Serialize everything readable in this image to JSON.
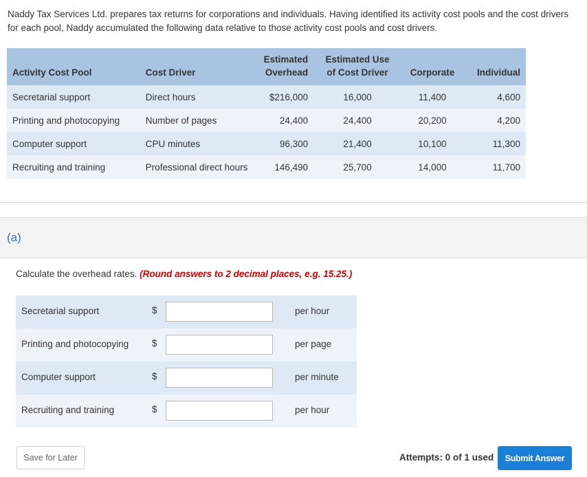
{
  "intro": "Naddy Tax Services Ltd. prepares tax returns for corporations and individuals. Having identified its activity cost pools and the cost drivers for each pool, Naddy accumulated the following data relative to those activity cost pools and cost drivers.",
  "table": {
    "headers": {
      "pool": "Activity Cost Pool",
      "driver": "Cost Driver",
      "overhead_line1": "Estimated",
      "overhead_line2": "Overhead",
      "use_line1": "Estimated Use",
      "use_line2": "of Cost Driver",
      "corporate": "Corporate",
      "individual": "Individual"
    },
    "rows": [
      {
        "pool": "Secretarial support",
        "driver": "Direct hours",
        "overhead": "$216,000",
        "use": "16,000",
        "corporate": "11,400",
        "individual": "4,600"
      },
      {
        "pool": "Printing and photocopying",
        "driver": "Number of pages",
        "overhead": "24,400",
        "use": "24,400",
        "corporate": "20,200",
        "individual": "4,200"
      },
      {
        "pool": "Computer support",
        "driver": "CPU minutes",
        "overhead": "96,300",
        "use": "21,400",
        "corporate": "10,100",
        "individual": "11,300"
      },
      {
        "pool": "Recruiting and training",
        "driver": "Professional direct hours",
        "overhead": "146,490",
        "use": "25,700",
        "corporate": "14,000",
        "individual": "11,700"
      }
    ]
  },
  "part_label": "(a)",
  "instruction": {
    "text": "Calculate the overhead rates. ",
    "emphasis": "(Round answers to 2 decimal places, e.g. 15.25.)"
  },
  "answers": [
    {
      "label": "Secretarial support",
      "currency": "$",
      "value": "",
      "unit": "per hour"
    },
    {
      "label": "Printing and photocopying",
      "currency": "$",
      "value": "",
      "unit": "per page"
    },
    {
      "label": "Computer support",
      "currency": "$",
      "value": "",
      "unit": "per minute"
    },
    {
      "label": "Recruiting and training",
      "currency": "$",
      "value": "",
      "unit": "per hour"
    }
  ],
  "footer": {
    "save_label": "Save for Later",
    "attempts": "Attempts: 0 of 1 used",
    "submit_label": "Submit Answer"
  },
  "colors": {
    "header_bg": "#a9c4e1",
    "row_alt_bg": "#dfe9f5",
    "submit_bg": "#1a7fd6",
    "emphasis": "#cc0000",
    "part_label": "#3a6fb0"
  }
}
